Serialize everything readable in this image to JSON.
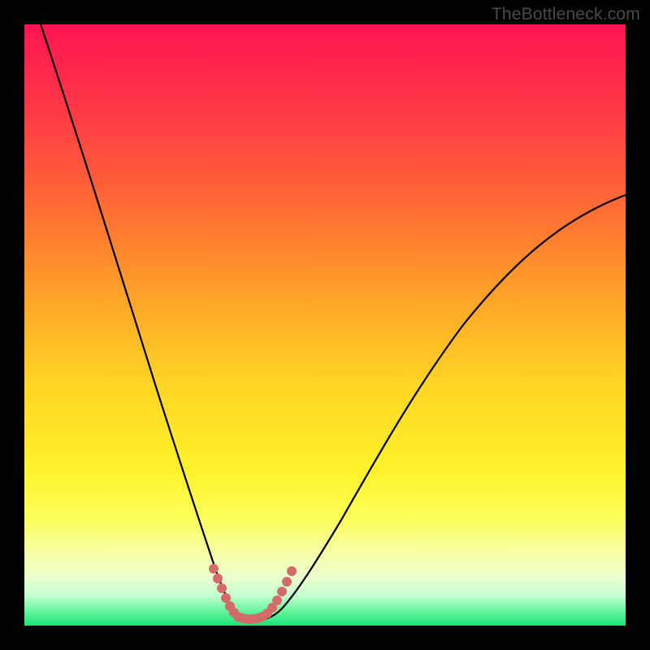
{
  "watermark": "TheBottleneck.com",
  "colors": {
    "top": "#ff1450",
    "upper": "#ff7e2a",
    "mid": "#ffe728",
    "lower": "#f8ff8a",
    "pale": "#f0ffc8",
    "green": "#17e676",
    "curve": "#000000",
    "marker": "#d46a6a"
  },
  "chart_data": {
    "type": "line",
    "title": "",
    "xlabel": "",
    "ylabel": "",
    "xlim": [
      0,
      100
    ],
    "ylim": [
      0,
      100
    ],
    "series": [
      {
        "name": "curve",
        "x": [
          0,
          5,
          10,
          15,
          20,
          25,
          28,
          30,
          32,
          33,
          34,
          36,
          38,
          40,
          42,
          44,
          47,
          50,
          55,
          60,
          65,
          70,
          75,
          80,
          85,
          90,
          95,
          100
        ],
        "values": [
          100,
          83,
          67,
          52,
          38,
          24,
          14,
          8,
          4,
          2,
          1,
          1,
          1,
          2,
          3,
          5,
          8,
          12,
          18,
          24,
          30,
          36,
          42,
          47,
          52,
          57,
          62,
          67
        ]
      },
      {
        "name": "markers",
        "x": [
          30,
          31,
          32,
          33,
          34,
          35,
          36,
          37,
          39,
          40,
          41,
          42,
          43
        ],
        "values": [
          6,
          4,
          3,
          2,
          1.5,
          1.5,
          1.5,
          1.5,
          2,
          3,
          4,
          5,
          6
        ]
      }
    ],
    "annotations": []
  }
}
